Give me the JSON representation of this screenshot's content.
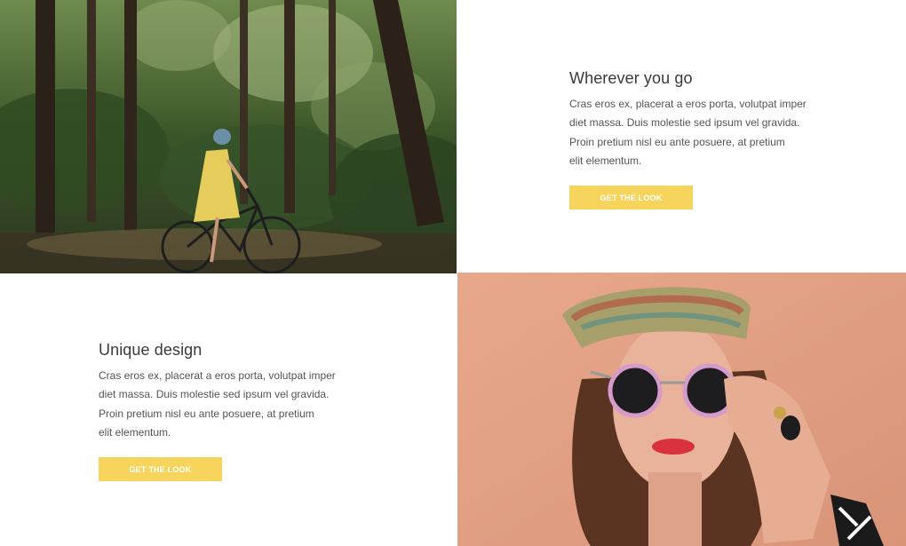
{
  "sections": [
    {
      "title": "Wherever you go",
      "body": "Cras eros ex, placerat a eros porta, volutpat imper\ndiet massa. Duis molestie sed ipsum vel gravida.\nProin pretium nisl eu ante posuere, at pretium\nelit elementum.",
      "button_label": "GET THE LOOK"
    },
    {
      "title": "Unique design",
      "body": "Cras eros ex, placerat a eros porta, volutpat imper\ndiet massa. Duis molestie sed ipsum vel gravida.\nProin pretium nisl eu ante posuere, at pretium\nelit elementum.",
      "button_label": "GET THE LOOK"
    }
  ],
  "colors": {
    "button": "#f7d55c",
    "heading": "#3a3a3a",
    "body_text": "#555555"
  }
}
